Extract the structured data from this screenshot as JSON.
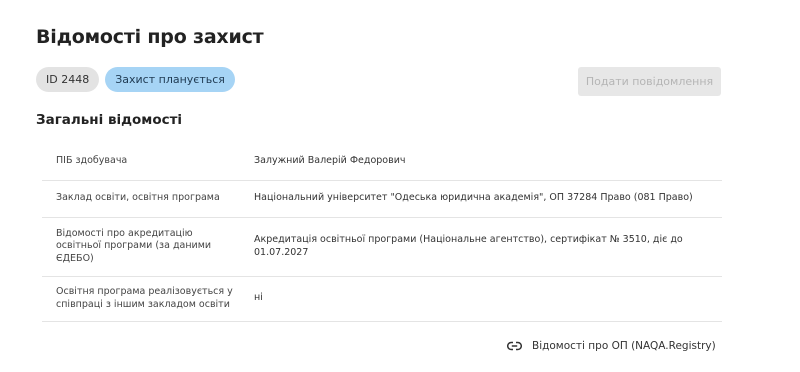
{
  "page": {
    "title": "Відомості про захист"
  },
  "badges": {
    "id": "ID 2448",
    "status": "Захист планується"
  },
  "actions": {
    "submit_label": "Подати повідомлення"
  },
  "section": {
    "title": "Загальні відомості"
  },
  "rows": [
    {
      "label": "ПІБ здобувача",
      "value": "Залужний Валерій Федорович"
    },
    {
      "label": "Заклад освіти, освітня програма",
      "value": "Національний університет \"Одеська юридична академія\", ОП 37284 Право (081 Право)"
    },
    {
      "label": "Відомості про акредитацію освітньої програми (за даними ЄДЕБО)",
      "value": "Акредитація освітньої програми (Національне агентство), сертифікат № 3510, діє до 01.07.2027"
    },
    {
      "label": "Освітня програма реалізовується у співпраці з іншим закладом освіти",
      "value": "ні"
    }
  ],
  "registry": {
    "link_label": "Відомості про ОП (NAQA.Registry)",
    "icon": "link-icon"
  }
}
